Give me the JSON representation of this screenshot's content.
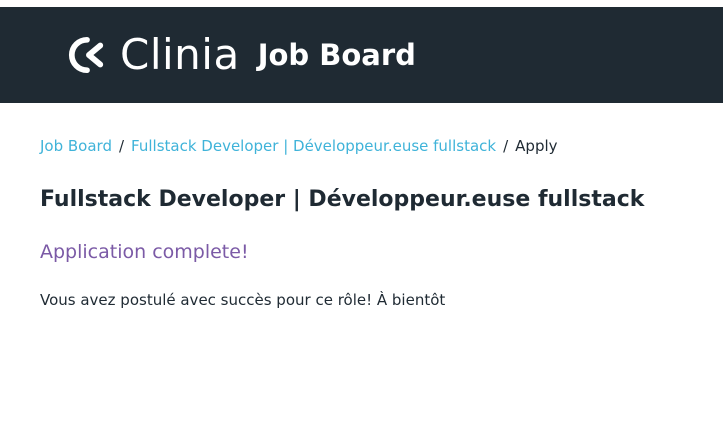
{
  "header": {
    "logo_text": "Clinia",
    "board_title": "Job Board",
    "logo_icon": "clinia-logo-icon",
    "background_color": "#1f2a33"
  },
  "breadcrumb": {
    "items": [
      {
        "label": "Job Board"
      },
      {
        "label": "Fullstack Developer | Développeur.euse fullstack"
      }
    ],
    "separator": "/",
    "current": "Apply",
    "link_color": "#3fb3d9"
  },
  "main": {
    "job_title": "Fullstack Developer | Développeur.euse fullstack",
    "status_heading": "Application complete!",
    "status_message": "Vous avez postulé avec succès pour ce rôle! À bientôt",
    "accent_color": "#7b5aa6"
  }
}
